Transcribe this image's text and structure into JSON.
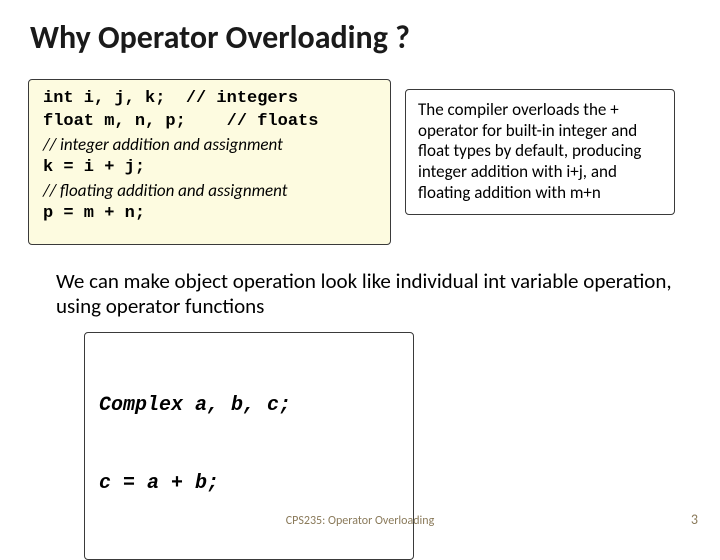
{
  "title": "Why Operator Overloading ?",
  "codebox": {
    "line1": "int i, j, k;  // integers",
    "line2": "float m, n, p;    // floats",
    "comment1": "// integer addition and assignment",
    "line3": "k = i + j;",
    "comment2": "// floating addition and assignment",
    "line4": "p = m + n;"
  },
  "sidebox": " The compiler overloads the + operator for built-in integer and float types by default, producing integer addition with i+j, and floating addition with m+n",
  "explain": "We can make object operation look like individual int variable operation, using operator functions",
  "complex": {
    "line1": "Complex a, b, c;",
    "line2": "c = a + b;"
  },
  "footer": "CPS235: Operator Overloading",
  "page": "3"
}
